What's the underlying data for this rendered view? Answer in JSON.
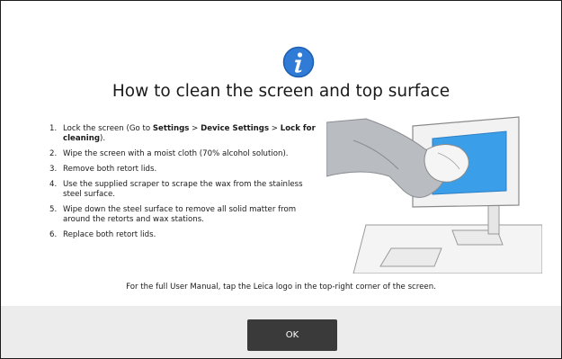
{
  "dialog": {
    "icon": "info-icon",
    "title": "How to clean the screen and top surface",
    "steps": [
      {
        "number": "1.",
        "prefix": "Lock the screen (Go to ",
        "bold1": "Settings",
        "mid1": " > ",
        "bold2": "Device Settings",
        "mid2": " > ",
        "bold3": "Lock for cleaning",
        "suffix": ")."
      },
      {
        "number": "2.",
        "text": "Wipe the screen with a moist cloth (70% alcohol solution)."
      },
      {
        "number": "3.",
        "text": "Remove both retort lids."
      },
      {
        "number": "4.",
        "text": "Use the supplied scraper to scrape the wax from the stainless steel surface."
      },
      {
        "number": "5.",
        "text": "Wipe down the steel surface to remove all solid matter from around the retorts and wax stations."
      },
      {
        "number": "6.",
        "text": "Replace both retort lids."
      }
    ],
    "footer_note": "For the full User Manual, tap the Leica logo in the top-right corner of the screen.",
    "ok_label": "OK"
  },
  "colors": {
    "info_icon_fill": "#2f7bd6",
    "screen_highlight": "#3b9ee8",
    "button_bar": "#ececec",
    "button": "#3a3a3a"
  }
}
